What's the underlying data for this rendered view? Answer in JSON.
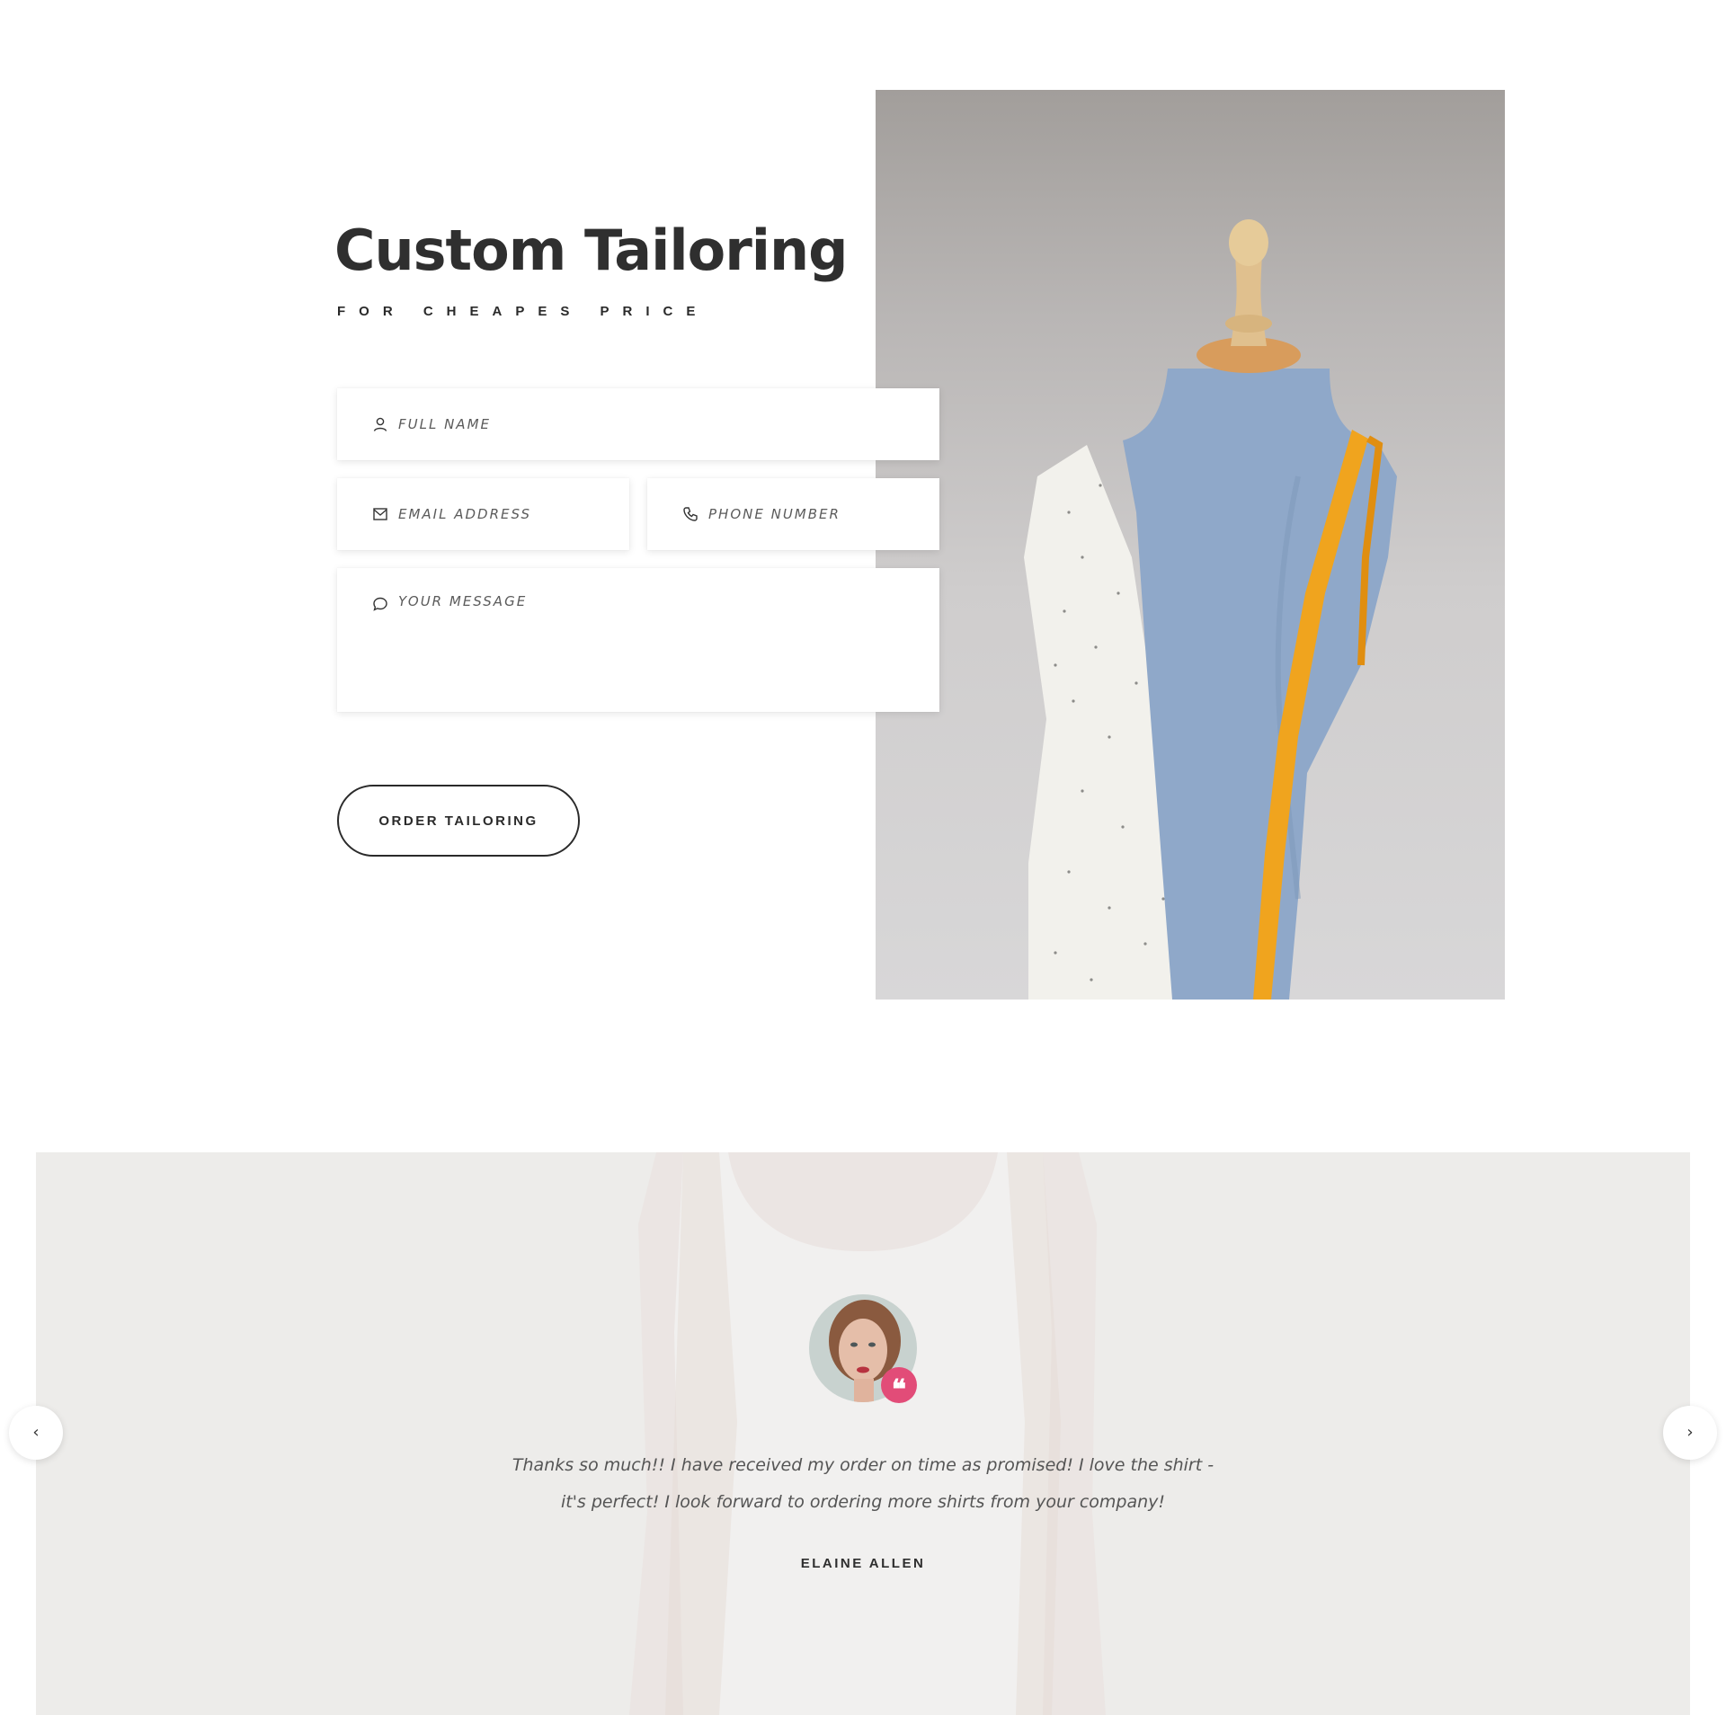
{
  "hero": {
    "title": "Custom Tailoring",
    "subtitle": "FOR CHEAPES PRICE",
    "image_alt": "blue-dress-form-mannequin-with-measuring-tape",
    "colors": {
      "photo_bg": "#c4c2c2",
      "mannequin": "#8fa8c9",
      "tape": "#f0a41e",
      "fabric": "#f2f1ec"
    }
  },
  "form": {
    "full_name": {
      "placeholder": "FULL NAME",
      "icon": "user-icon"
    },
    "email": {
      "placeholder": "EMAIL ADDRESS",
      "icon": "mail-icon"
    },
    "phone": {
      "placeholder": "PHONE NUMBER",
      "icon": "phone-icon"
    },
    "message": {
      "placeholder": "YOUR MESSAGE",
      "icon": "chat-bubble-icon"
    },
    "submit_label": "ORDER TAILORING"
  },
  "testimonial": {
    "quote": "Thanks so much!! I have received my order on time as promised! I love the shirt - it's perfect! I look forward to ordering more shirts from your company!",
    "author": "ELAINE ALLEN",
    "quote_mark": "❝",
    "prev_label": "‹",
    "next_label": "›",
    "colors": {
      "section_bg": "#edecea",
      "badge": "#e24c78"
    }
  }
}
